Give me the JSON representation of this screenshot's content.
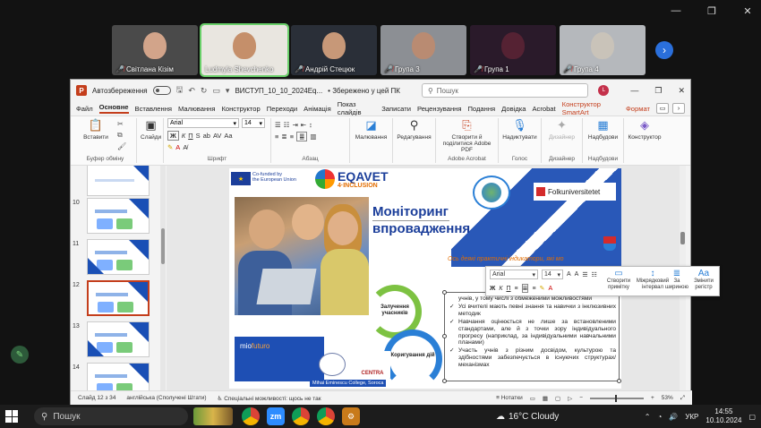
{
  "meeting": {
    "participants": [
      {
        "name": "Світлана Кізім",
        "muted": true,
        "bg": "#4a4a4a",
        "face": "#d2a48a"
      },
      {
        "name": "Ludmyla Shevchenko",
        "muted": false,
        "bg": "#e9e6e0",
        "face": "#c58f6a"
      },
      {
        "name": "Андрій Стецюк",
        "muted": true,
        "bg": "#2a2f38",
        "face": "#c79878"
      },
      {
        "name": "Група 3",
        "muted": true,
        "bg": "#8c8f94",
        "face": "#b98b72"
      },
      {
        "name": "Група 1",
        "muted": true,
        "bg": "#2a1a2a",
        "face": "#552233"
      },
      {
        "name": "Група 4",
        "muted": true,
        "bg": "#b5b8bc",
        "face": "#c9c3b9"
      }
    ],
    "next_icon": "chevron-right-icon"
  },
  "ppt": {
    "autosave_label": "Автозбереження",
    "file_name": "ВИСТУП_10_10_2024Eq...",
    "saved_status": "• Збережено у цей ПК",
    "search_placeholder": "Пошук",
    "user_initial": "L",
    "tabs": [
      "Файл",
      "Основне",
      "Вставлення",
      "Малювання",
      "Конструктор",
      "Переходи",
      "Анімація",
      "Показ слайдів",
      "Записати",
      "Рецензування",
      "Подання",
      "Довідка",
      "Acrobat",
      "Конструктор SmartArt",
      "Формат"
    ],
    "active_tab": "Основне",
    "ribbon": {
      "paste": "Вставити",
      "clipboard_group": "Буфер обміну",
      "slides": "Слайди",
      "font_name": "Arial",
      "font_size": "14",
      "font_group": "Шрифт",
      "paragraph_group": "Абзац",
      "drawing": "Малювання",
      "editing": "Редагування",
      "acrobat_btn": "Створити й поділитися Adobe PDF",
      "acrobat_group": "Adobe Acrobat",
      "dictate": "Надиктувати",
      "voice_group": "Голос",
      "designer": "Дизайнер",
      "designer_group": "Дизайнер",
      "addins": "Надбудови",
      "addins_group": "Надбудови",
      "constructor": "Конструктор"
    },
    "thumb_numbers": [
      "10",
      "11",
      "12",
      "13",
      "14"
    ],
    "selected_thumb": "12",
    "slide": {
      "eu_text_1": "Co-funded by",
      "eu_text_2": "the European Union",
      "brand_1": "EQAVET",
      "brand_2": "4·INCLUSION",
      "folk": "Folkuniversitetet",
      "title_1": "Моніторинг",
      "title_2": "впровадження",
      "subtitle": "Ось деякі практичні індикатори, які мо",
      "ring_1": "Залучення учасників",
      "ring_2": "Коригування дій",
      "bullets": [
        "учнів, у тому числі з обмеженими можливостями",
        "Усі вчителі мають певні знання та навички з інклюзивних методик",
        "Навчання оцінюється не лише за встановленими стандартами, але й з точки зору індивідуального прогресу (наприклад, за індивідуальними навчальними планами)",
        "Участь учнів з різним досвідом, культурою та здібностями забезпечується в існуючих структурах/механізмах"
      ],
      "mio": "mio",
      "mio_2": "futuro",
      "cmb": "CENTRA",
      "college": "Mihai Eminescu College, Soroca"
    },
    "mini_toolbar": {
      "font": "Arial",
      "size": "14",
      "create_note": "Створити примітку",
      "line_spacing": "Міжрядковий інтервал",
      "justify": "За шириною",
      "change_case": "Змінити регістр"
    },
    "status": {
      "slide_of": "Слайд 12 з 34",
      "language": "англійська (Сполучені Штати)",
      "accessibility": "Спеціальні можливості: щось не так",
      "notes": "Нотатки",
      "zoom": "53%"
    }
  },
  "taskbar": {
    "search": "Пошук",
    "weather": "16°C  Cloudy",
    "lang": "УКР",
    "time": "14:55",
    "date": "10.10.2024",
    "apps": [
      {
        "name": "chrome",
        "label": "",
        "color": "#db4437"
      },
      {
        "name": "zoom",
        "label": "zm",
        "color": "#2d8cff"
      },
      {
        "name": "chrome-2",
        "label": "",
        "color": "#db4437"
      },
      {
        "name": "chrome-3",
        "label": "",
        "color": "#db4437"
      },
      {
        "name": "settings",
        "label": "⚙",
        "color": "#c87a1a"
      }
    ]
  }
}
